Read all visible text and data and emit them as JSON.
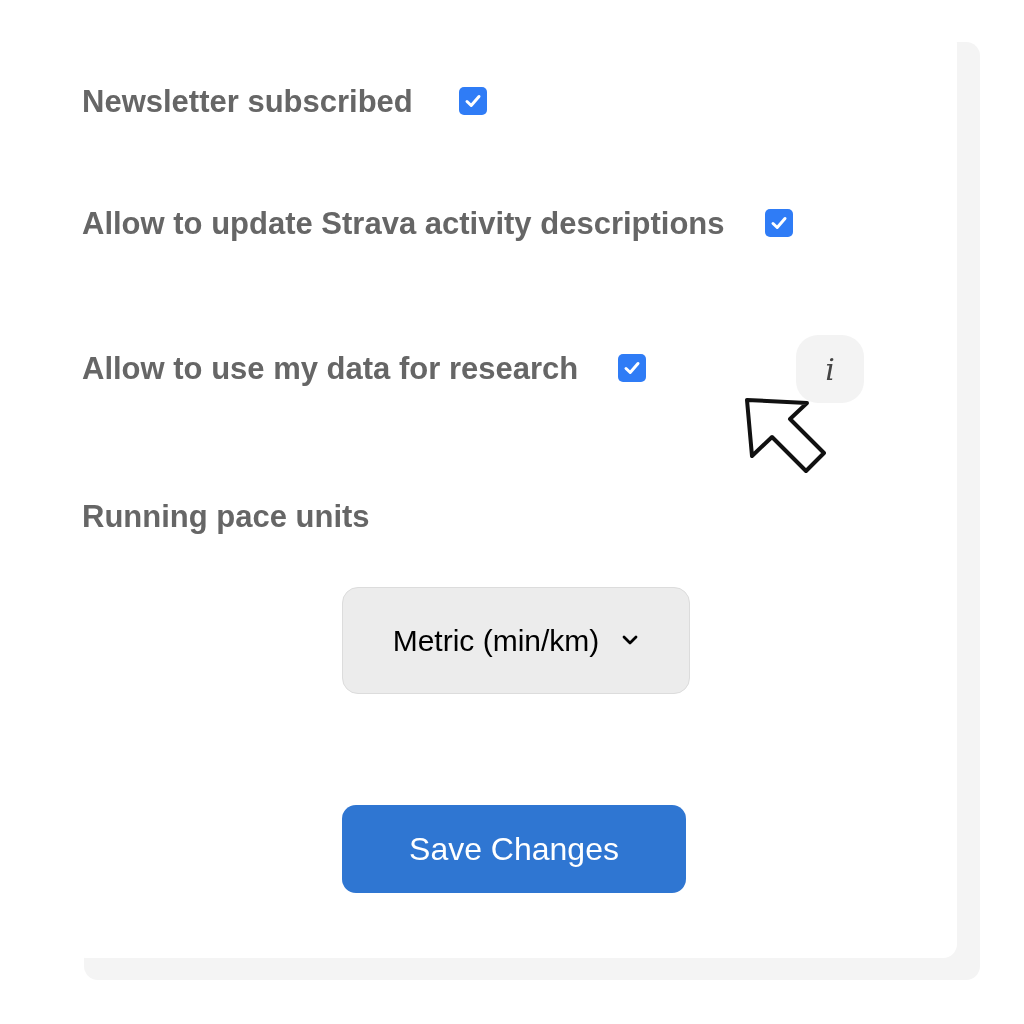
{
  "settings": [
    {
      "label": "Newsletter subscribed",
      "checked": true
    },
    {
      "label": "Allow to update Strava activity descriptions",
      "checked": true
    },
    {
      "label": "Allow to use my data for research",
      "checked": true,
      "info": "i"
    }
  ],
  "pace_units": {
    "label": "Running pace units",
    "value": "Metric (min/km)"
  },
  "save_button": "Save Changes"
}
